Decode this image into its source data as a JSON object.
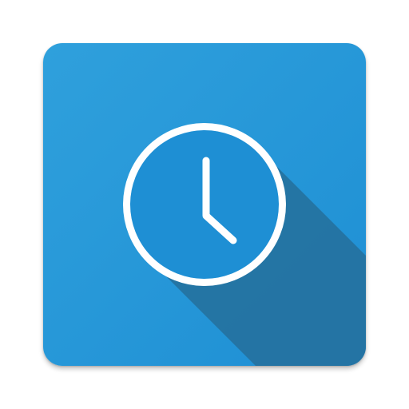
{
  "app_icon": {
    "icon": "clock-icon",
    "colors": {
      "tile_light": "#2fa0dc",
      "tile_dark": "#1e8fd4",
      "long_shadow": "#25719f",
      "clock_stroke": "#ffffff"
    }
  }
}
